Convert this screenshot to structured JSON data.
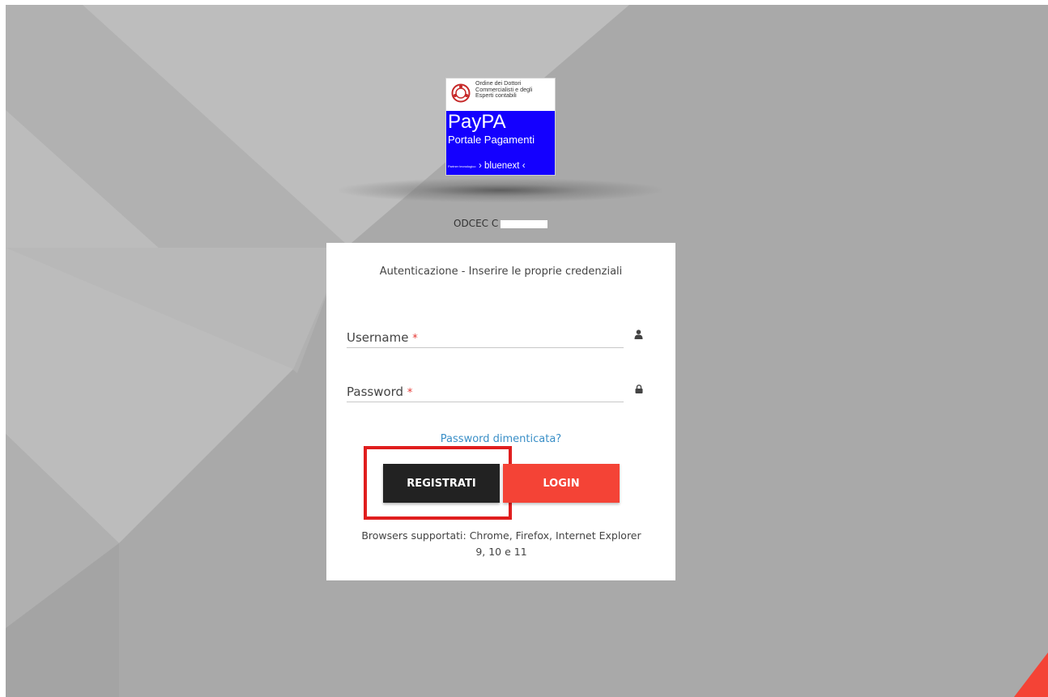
{
  "logo": {
    "org_line1": "Ordine dei Dottori",
    "org_line2": "Commercialisti e degli",
    "org_line3": "Esperti contabili",
    "brand": "PayPA",
    "subtitle": "Portale Pagamenti",
    "partner_label": "Partner tecnologico",
    "partner_name": "› bluenext ‹"
  },
  "organization": {
    "name": "ODCEC C"
  },
  "login": {
    "title": "Autenticazione - Inserire le proprie credenziali",
    "username_label": "Username",
    "password_label": "Password",
    "required_mark": "*",
    "forgot_link": "Password dimenticata?",
    "register_button": "REGISTRATI",
    "login_button": "LOGIN",
    "browsers_note": "Browsers supportati: Chrome, Firefox, Internet Explorer 9, 10 e 11"
  },
  "icons": {
    "username": "user-icon",
    "password": "lock-icon"
  },
  "colors": {
    "background": "#a9a9a9",
    "login_button": "#f44336",
    "register_button": "#222222",
    "link": "#3a8fc7",
    "logo_blue": "#1400ff",
    "highlight": "#e01e1e"
  }
}
